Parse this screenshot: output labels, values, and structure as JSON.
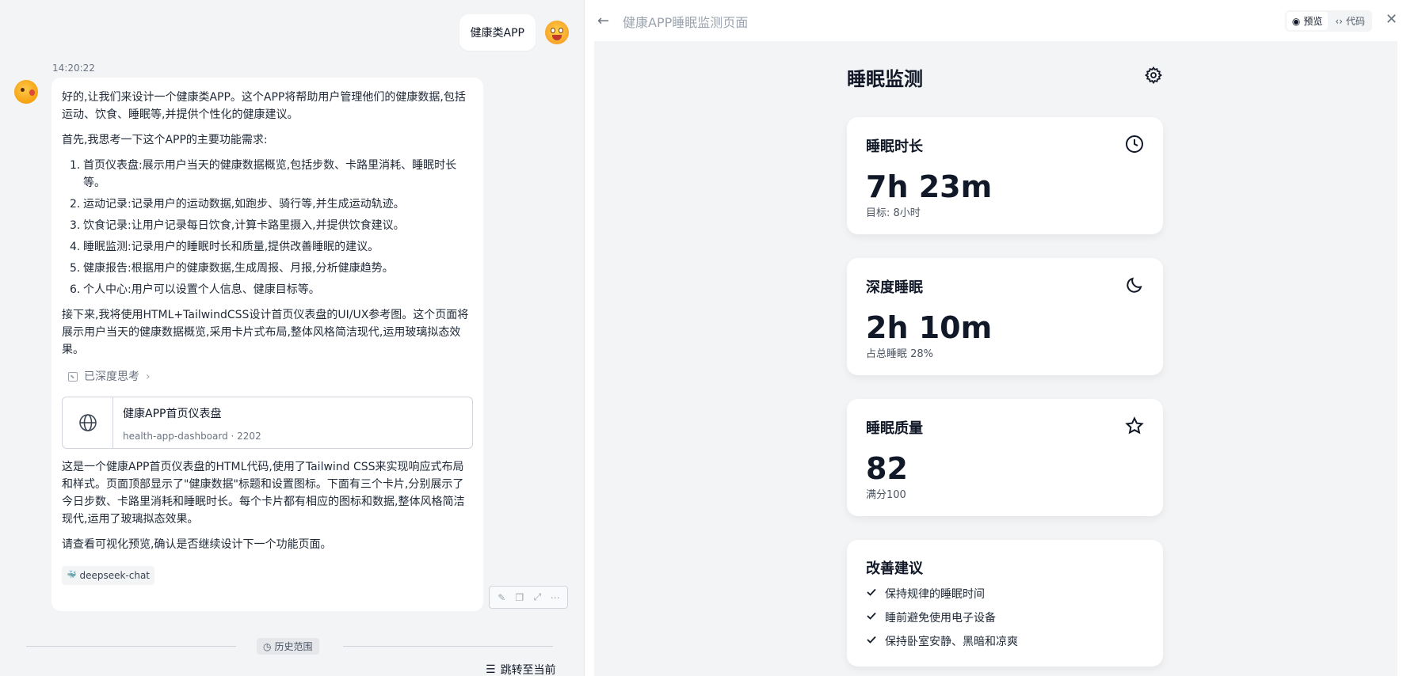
{
  "chat": {
    "user_message": "健康类APP",
    "timestamp": "14:20:22",
    "paragraphs": [
      "好的,让我们来设计一个健康类APP。这个APP将帮助用户管理他们的健康数据,包括运动、饮食、睡眠等,并提供个性化的健康建议。",
      "首先,我思考一下这个APP的主要功能需求:"
    ],
    "features": [
      {
        "num": "1.",
        "text": "首页仪表盘:展示用户当天的健康数据概览,包括步数、卡路里消耗、睡眠时长等。"
      },
      {
        "num": "2.",
        "text": "运动记录:记录用户的运动数据,如跑步、骑行等,并生成运动轨迹。"
      },
      {
        "num": "3.",
        "text": "饮食记录:让用户记录每日饮食,计算卡路里摄入,并提供饮食建议。"
      },
      {
        "num": "4.",
        "text": "睡眠监测:记录用户的睡眠时长和质量,提供改善睡眠的建议。"
      },
      {
        "num": "5.",
        "text": "健康报告:根据用户的健康数据,生成周报、月报,分析健康趋势。"
      },
      {
        "num": "6.",
        "text": "个人中心:用户可以设置个人信息、健康目标等。"
      }
    ],
    "next_paragraph": "接下来,我将使用HTML+TailwindCSS设计首页仪表盘的UI/UX参考图。这个页面将展示用户当天的健康数据概览,采用卡片式布局,整体风格简洁现代,运用玻璃拟态效果。",
    "deep_think_label": "已深度思考",
    "artifact": {
      "title": "健康APP首页仪表盘",
      "subtitle": "health-app-dashboard · 2202"
    },
    "summary_paragraph": "这是一个健康APP首页仪表盘的HTML代码,使用了Tailwind CSS来实现响应式布局和样式。页面顶部显示了\"健康数据\"标题和设置图标。下面有三个卡片,分别展示了今日步数、卡路里消耗和睡眠时长。每个卡片都有相应的图标和数据,整体风格简洁现代,运用了玻璃拟态效果。",
    "closing_paragraph": "请查看可视化预览,确认是否继续设计下一个功能页面。",
    "model_tag": "deepseek-chat",
    "history_label": "历史范围",
    "jump_label": "跳转至当前"
  },
  "preview": {
    "title": "健康APP睡眠监测页面",
    "tab_preview": "预览",
    "tab_code": "代码",
    "page": {
      "title": "睡眠监测",
      "cards": [
        {
          "title": "睡眠时长",
          "value": "7h 23m",
          "sub": "目标: 8小时",
          "icon": "clock-icon"
        },
        {
          "title": "深度睡眠",
          "value": "2h 10m",
          "sub": "占总睡眠 28%",
          "icon": "moon-icon"
        },
        {
          "title": "睡眠质量",
          "value": "82",
          "sub": "满分100",
          "icon": "star-icon"
        }
      ],
      "tips_title": "改善建议",
      "tips": [
        "保持规律的睡眠时间",
        "睡前避免使用电子设备",
        "保持卧室安静、黑暗和凉爽"
      ]
    }
  }
}
